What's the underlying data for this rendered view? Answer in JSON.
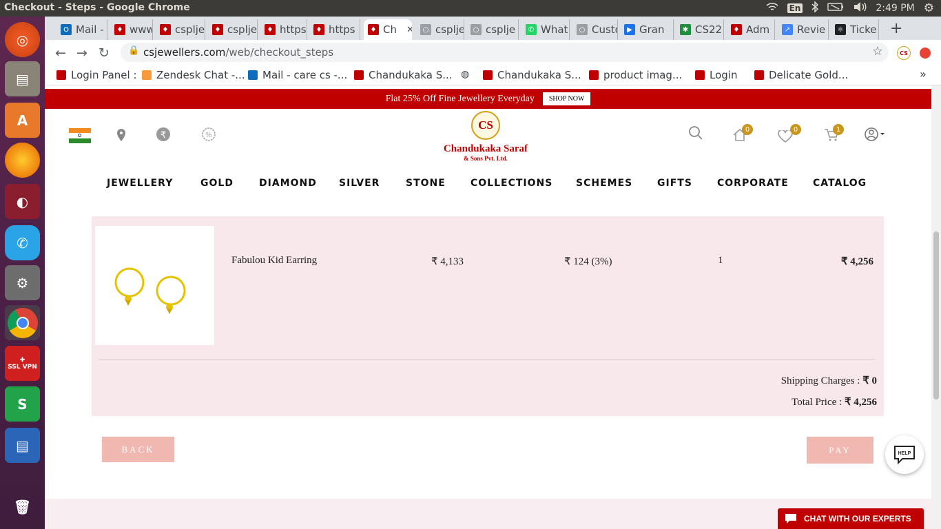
{
  "window": {
    "title": "Checkout - Steps - Google Chrome"
  },
  "system": {
    "lang": "En",
    "time": "2:49 PM"
  },
  "tabs": [
    {
      "label": "Mail -",
      "color": "#0f6cbd",
      "glyph": "O"
    },
    {
      "label": "www",
      "color": "#c00000",
      "glyph": "♦"
    },
    {
      "label": "csplje",
      "color": "#c00000",
      "glyph": "♦"
    },
    {
      "label": "csplje",
      "color": "#c00000",
      "glyph": "♦"
    },
    {
      "label": "https",
      "color": "#c00000",
      "glyph": "♦"
    },
    {
      "label": "https",
      "color": "#c00000",
      "glyph": "♦"
    },
    {
      "label": "Ch",
      "color": "#c00000",
      "glyph": "♦"
    },
    {
      "label": "csplje",
      "color": "#9aa0a6",
      "glyph": "○"
    },
    {
      "label": "csplje",
      "color": "#9aa0a6",
      "glyph": "○"
    },
    {
      "label": "What",
      "color": "#25d366",
      "glyph": "✆"
    },
    {
      "label": "Custo",
      "color": "#9aa0a6",
      "glyph": "○"
    },
    {
      "label": "Gran",
      "color": "#1a73e8",
      "glyph": "▶"
    },
    {
      "label": "CS22",
      "color": "#1e8e3e",
      "glyph": "✱"
    },
    {
      "label": "Adm",
      "color": "#c00000",
      "glyph": "♦"
    },
    {
      "label": "Revie",
      "color": "#4285f4",
      "glyph": "↗"
    },
    {
      "label": "Ticke",
      "color": "#202124",
      "glyph": "⚛"
    }
  ],
  "address": {
    "host": "csjewellers.com",
    "path": "/web/checkout_steps"
  },
  "bookmarks": [
    {
      "label": "Login Panel :",
      "color": "#c00000"
    },
    {
      "label": "Zendesk Chat -...",
      "color": "#f79a3e"
    },
    {
      "label": "Mail - care cs -...",
      "color": "#0f6cbd"
    },
    {
      "label": "Chandukaka S...",
      "color": "#c00000"
    },
    {
      "label": "Chandukaka S...",
      "color": "#c00000"
    },
    {
      "label": "product imag...",
      "color": "#c00000"
    },
    {
      "label": "Login",
      "color": "#c00000"
    },
    {
      "label": "Delicate Gold...",
      "color": "#c00000"
    }
  ],
  "promo": {
    "text": "Flat 25% Off Fine Jewellery Everyday",
    "cta": "SHOP NOW"
  },
  "logo": {
    "mark": "CS",
    "name": "Chandukaka Saraf",
    "sub": "& Sons Pvt. Ltd."
  },
  "header": {
    "home_count": "0",
    "wishlist_count": "0",
    "cart_count": "1"
  },
  "menu": [
    "JEWELLERY",
    "GOLD",
    "DIAMOND",
    "SILVER",
    "STONE",
    "COLLECTIONS",
    "SCHEMES",
    "GIFTS",
    "CORPORATE",
    "CATALOG"
  ],
  "order": {
    "product": "Fabulou Kid Earring",
    "price": "₹ 4,133",
    "tax": "₹ 124 (3%)",
    "qty": "1",
    "line_total": "₹ 4,256",
    "shipping_label": "Shipping Charges :",
    "shipping_value": "₹ 0",
    "total_label": "Total Price :",
    "total_value": "₹ 4,256"
  },
  "buttons": {
    "back": "BACK",
    "pay": "PAY"
  },
  "help": {
    "label": "HELP"
  },
  "chat": {
    "label": "CHAT WITH OUR EXPERTS"
  },
  "colors": {
    "brand_red": "#c00000",
    "gold": "#c9961e",
    "panel_pink": "#f8e8ec",
    "button_pink": "#f0b8b0"
  }
}
